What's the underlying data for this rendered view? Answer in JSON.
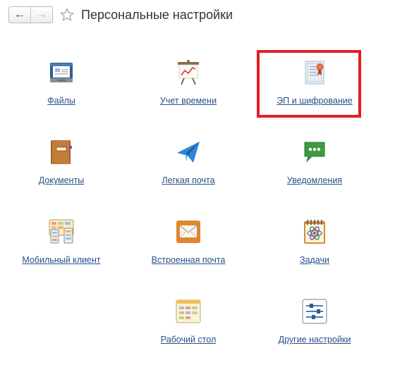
{
  "header": {
    "title": "Персональные настройки",
    "back_icon": "arrow-left-icon",
    "forward_icon": "arrow-right-icon",
    "favorite_icon": "star-icon"
  },
  "highlight_color": "#e21f26",
  "link_color": "#2a4f8a",
  "tiles": [
    {
      "label": "Файлы",
      "icon": "files-icon"
    },
    {
      "label": "Учет времени",
      "icon": "time-tracking-icon"
    },
    {
      "label": "ЭП и шифрование",
      "icon": "certificate-icon",
      "highlighted": true
    },
    {
      "label": "Документы",
      "icon": "documents-icon"
    },
    {
      "label": "Легкая почта",
      "icon": "paper-plane-icon"
    },
    {
      "label": "Уведомления",
      "icon": "chat-bubble-icon"
    },
    {
      "label": "Мобильный клиент",
      "icon": "mobile-client-icon"
    },
    {
      "label": "Встроенная почта",
      "icon": "envelope-icon"
    },
    {
      "label": "Задачи",
      "icon": "tasks-icon"
    },
    {
      "label": "Рабочий стол",
      "icon": "desktop-icon"
    },
    {
      "label": "Другие настройки",
      "icon": "sliders-icon"
    }
  ]
}
